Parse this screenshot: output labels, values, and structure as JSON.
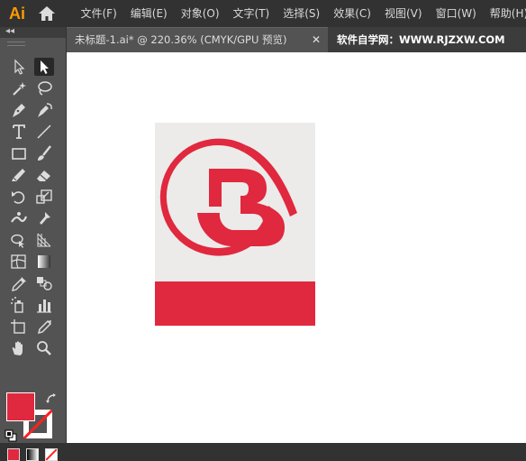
{
  "app": {
    "logo_text": "Ai"
  },
  "menu": [
    "文件(F)",
    "编辑(E)",
    "对象(O)",
    "文字(T)",
    "选择(S)",
    "效果(C)",
    "视图(V)",
    "窗口(W)",
    "帮助(H)"
  ],
  "tabs": {
    "document_label": "未标题-1.ai* @ 220.36% (CMYK/GPU 预览)",
    "close_glyph": "✕",
    "watermark_label": "软件自学网：WWW.RJZXW.COM"
  },
  "tools_panel": {
    "collapse_glyph": "◂◂",
    "tools": [
      "selection-tool",
      "direct-selection-tool",
      "magic-wand-tool",
      "lasso-tool",
      "pen-tool",
      "curvature-tool",
      "type-tool",
      "line-segment-tool",
      "rectangle-tool",
      "paintbrush-tool",
      "shaper-tool",
      "eraser-tool",
      "rotate-tool",
      "scale-tool",
      "width-tool",
      "puppet-warp-tool",
      "shape-builder-tool",
      "perspective-grid-tool",
      "mesh-tool",
      "gradient-tool",
      "eyedropper-tool",
      "blend-tool",
      "symbol-sprayer-tool",
      "column-graph-tool",
      "artboard-tool",
      "slice-tool",
      "hand-tool",
      "zoom-tool"
    ],
    "selected_tool": "direct-selection-tool"
  },
  "colors": {
    "fill": "#e0283e",
    "stroke": "none",
    "artboard_background": "#ecebe9",
    "logo": "#e0283e",
    "canvas": "#ffffff",
    "ui_dark": "#323232",
    "ui_panel": "#535353"
  },
  "artwork": {
    "elements": [
      "circle-arc-logo",
      "letter-b-shape",
      "red-bottom-bar"
    ]
  }
}
